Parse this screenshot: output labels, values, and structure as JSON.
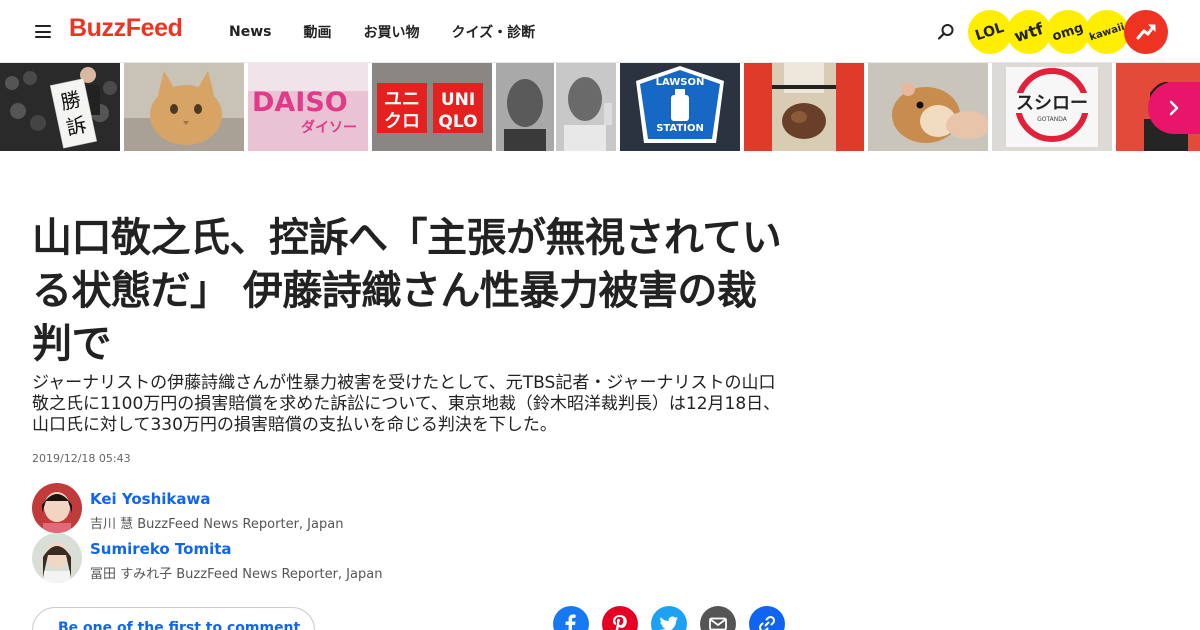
{
  "header": {
    "logo": "BuzzFeed",
    "nav": [
      "News",
      "動画",
      "お買い物",
      "クイズ・診断"
    ],
    "badges": [
      "LOL",
      "wtf",
      "omg",
      "kawaii"
    ]
  },
  "thumbnails": [
    {
      "icon": "handwritten-banner-thumb",
      "text": "勝訴"
    },
    {
      "icon": "cat-thumb"
    },
    {
      "icon": "daiso-thumb",
      "text": "DAISO",
      "sub": "ダイソー"
    },
    {
      "icon": "uniqlo-thumb",
      "text_jp": [
        "ユニ",
        "クロ"
      ],
      "text_en": [
        "UNI",
        "QLO"
      ]
    },
    {
      "icon": "portraits-thumb"
    },
    {
      "icon": "lawson-station-thumb",
      "text_top": "LAWSON",
      "text_bottom": "STATION"
    },
    {
      "icon": "fashion-bag-thumb"
    },
    {
      "icon": "hamster-thumb"
    },
    {
      "icon": "sushiro-thumb",
      "text": "スシロー",
      "sub": "GOTANDA"
    },
    {
      "icon": "woman-thumb"
    }
  ],
  "article": {
    "title": "山口敬之氏、控訴へ「主張が無視されている状態だ」 伊藤詩織さん性暴力被害の裁判で",
    "description": "ジャーナリストの伊藤詩織さんが性暴力被害を受けたとして、元TBS記者・ジャーナリストの山口敬之氏に1100万円の損害賠償を求めた訴訟について、東京地裁（鈴木昭洋裁判長）は12月18日、山口氏に対して330万円の損害賠償の支払いを命じる判決を下した。",
    "timestamp": "2019/12/18 05:43"
  },
  "authors": [
    {
      "name": "Kei Yoshikawa",
      "role": "吉川 慧 BuzzFeed News Reporter, Japan"
    },
    {
      "name": "Sumireko Tomita",
      "role": "冨田 すみれ子 BuzzFeed News Reporter, Japan"
    }
  ],
  "comment_label": "Be one of the first to comment ↓",
  "share_icons": [
    "facebook-icon",
    "pinterest-icon",
    "twitter-icon",
    "email-icon",
    "link-icon"
  ],
  "colors": {
    "brand": "#ee3322",
    "link": "#0f65ef",
    "badge": "#ffee00",
    "next": "#e8156b",
    "facebook": "#1877f2",
    "pinterest": "#e60023",
    "twitter": "#1da1f2",
    "email": "#555555",
    "copylink": "#0f65ef"
  }
}
